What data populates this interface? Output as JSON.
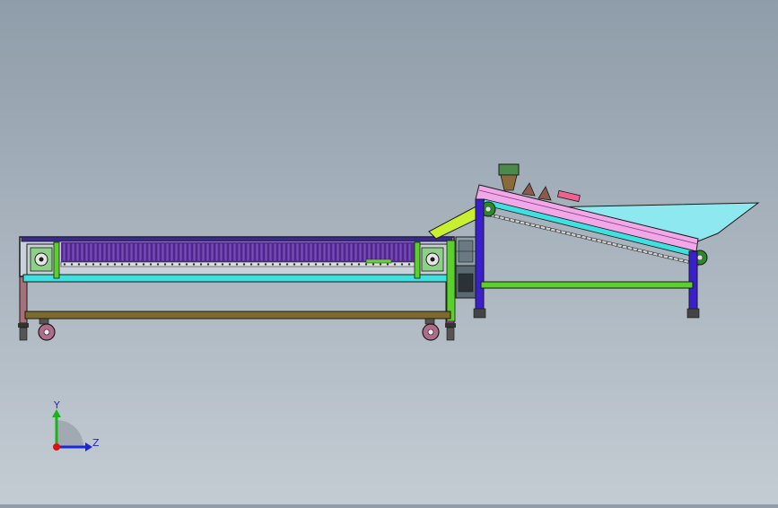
{
  "viewport": {
    "background_top": "#8f9daa",
    "background_bottom": "#c4ccd3"
  },
  "triad": {
    "y_label": "Y",
    "z_label": "Z",
    "y_color": "#1db21d",
    "z_color": "#1a28d8",
    "x_color": "#e01010"
  },
  "machine": {
    "belt_color": "#5a2f96",
    "frame_color": "#1a1a1a",
    "rail_color": "#3fe0e0",
    "leg_color": "#a8707a",
    "shelf_color": "#7d6a2c",
    "green_color": "#5ad12a",
    "incline_leg_color": "#3a1fd0",
    "incline_deck_color": "#f0a8e8",
    "hopper_color": "#8ee8f0",
    "chute_color": "#c8f030"
  }
}
